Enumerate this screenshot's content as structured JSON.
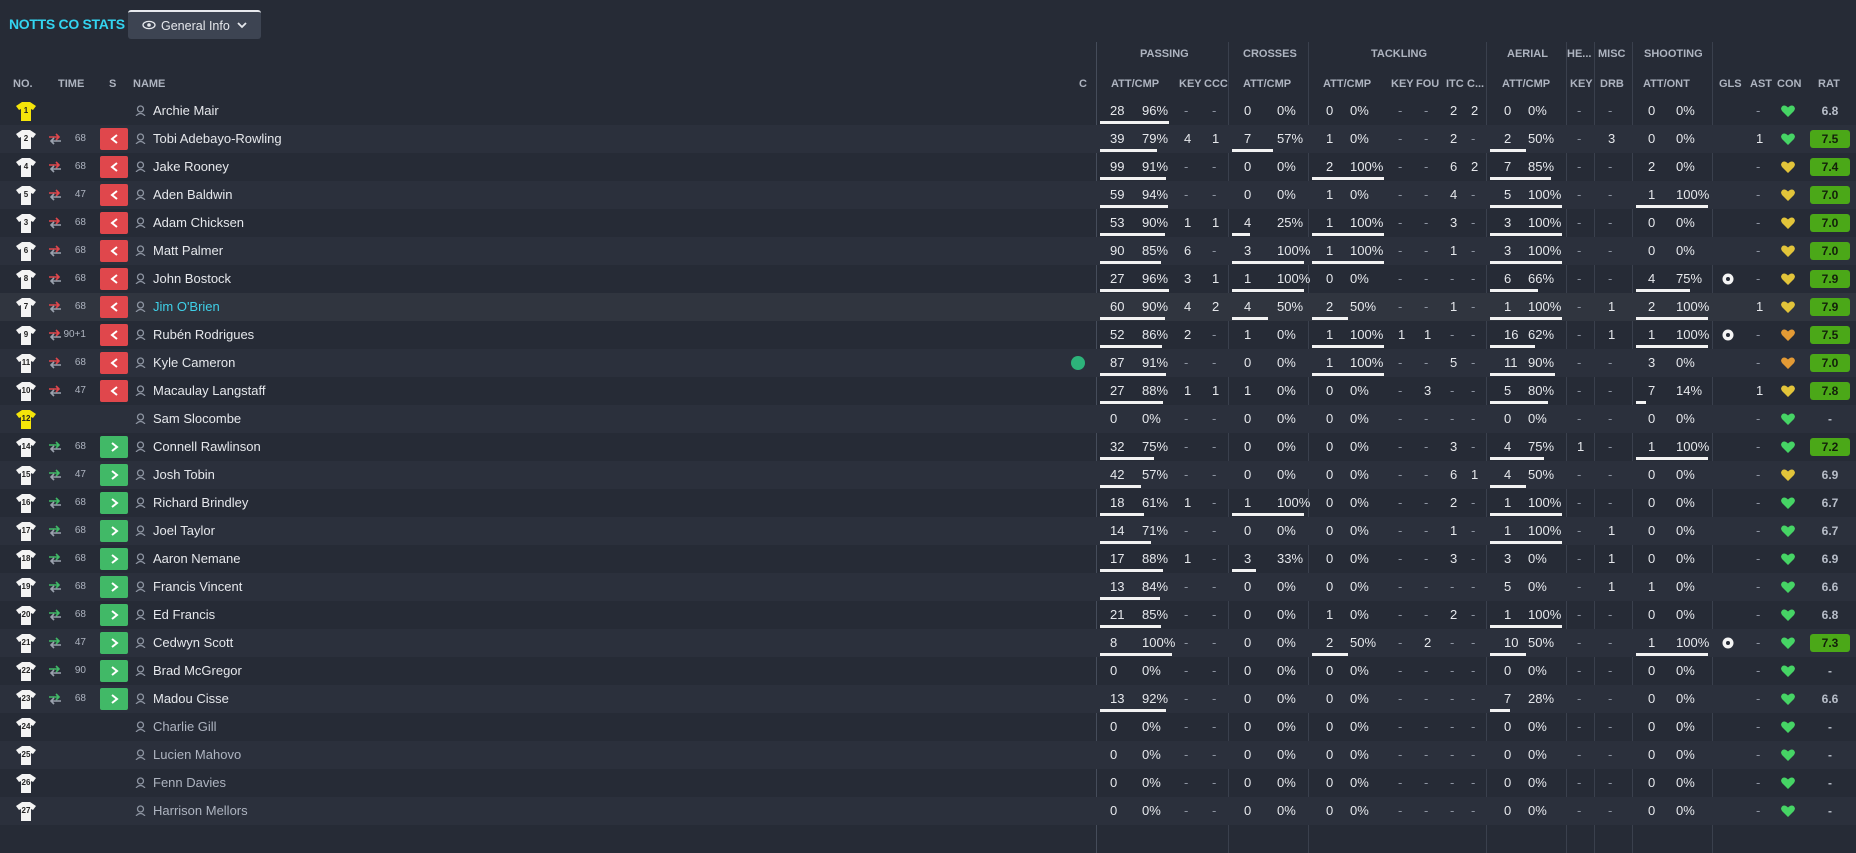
{
  "header": {
    "brand": "NOTTS CO STATS",
    "view_label": "General Info"
  },
  "groups": {
    "passing": "PASSING",
    "crosses": "CROSSES",
    "tackling": "TACKLING",
    "aerial": "AERIAL",
    "headers": "HE...",
    "misc": "MISC",
    "shooting": "SHOOTING"
  },
  "columns": {
    "no": "NO.",
    "time": "TIME",
    "s": "S",
    "name": "NAME",
    "c": "C",
    "pass_att": "ATT/CMP",
    "key": "KEY",
    "ccc": "CCC",
    "cross_att": "ATT/CMP",
    "tack_att": "ATT/CMP",
    "tkey": "KEY",
    "fou": "FOU",
    "itc": "ITC",
    "c2": "C...",
    "aer_att": "ATT/CMP",
    "hkey": "KEY",
    "drb": "DRB",
    "shot_att": "ATT/ONT",
    "gls": "GLS",
    "ast": "AST",
    "con": "CON",
    "rat": "RAT"
  },
  "colors": {
    "accent": "#33d4f0",
    "sub_off": "#e0474c",
    "sub_on": "#41b967",
    "rating_green": "#4ba818"
  },
  "players": [
    {
      "no": "1",
      "gk": true,
      "time": "",
      "sub": "",
      "name": "Archie Mair",
      "pa": "28",
      "pp": "96%",
      "pf": 0.96,
      "key": "-",
      "ccc": "-",
      "ca": "0",
      "cp": "0%",
      "cf": 0,
      "ta": "0",
      "tp": "0%",
      "tf": 0,
      "tk": "-",
      "fou": "-",
      "itc": "2",
      "c2": "2",
      "aa": "0",
      "ap": "0%",
      "af": 0,
      "hk": "-",
      "drb": "-",
      "sa": "0",
      "sp": "0%",
      "sf": 0,
      "gls": "",
      "ast": "-",
      "con": "green",
      "rat": "6.8",
      "rg": false
    },
    {
      "no": "2",
      "gk": false,
      "time": "68",
      "sub": "off",
      "name": "Tobi Adebayo-Rowling",
      "pa": "39",
      "pp": "79%",
      "pf": 0.79,
      "key": "4",
      "ccc": "1",
      "ca": "7",
      "cp": "57%",
      "cf": 0.57,
      "ta": "1",
      "tp": "0%",
      "tf": 0,
      "tk": "-",
      "fou": "-",
      "itc": "2",
      "c2": "-",
      "aa": "2",
      "ap": "50%",
      "af": 0.5,
      "hk": "-",
      "drb": "3",
      "sa": "0",
      "sp": "0%",
      "sf": 0,
      "gls": "",
      "ast": "1",
      "con": "green",
      "rat": "7.5",
      "rg": true
    },
    {
      "no": "4",
      "gk": false,
      "time": "68",
      "sub": "off",
      "name": "Jake Rooney",
      "pa": "99",
      "pp": "91%",
      "pf": 0.91,
      "key": "-",
      "ccc": "-",
      "ca": "0",
      "cp": "0%",
      "cf": 0,
      "ta": "2",
      "tp": "100%",
      "tf": 1,
      "tk": "-",
      "fou": "-",
      "itc": "6",
      "c2": "2",
      "aa": "7",
      "ap": "85%",
      "af": 0.85,
      "hk": "-",
      "drb": "-",
      "sa": "2",
      "sp": "0%",
      "sf": 0,
      "gls": "",
      "ast": "-",
      "con": "yellow",
      "rat": "7.4",
      "rg": true
    },
    {
      "no": "5",
      "gk": false,
      "time": "47",
      "sub": "off",
      "name": "Aden Baldwin",
      "pa": "59",
      "pp": "94%",
      "pf": 0.94,
      "key": "-",
      "ccc": "-",
      "ca": "0",
      "cp": "0%",
      "cf": 0,
      "ta": "1",
      "tp": "0%",
      "tf": 0,
      "tk": "-",
      "fou": "-",
      "itc": "4",
      "c2": "-",
      "aa": "5",
      "ap": "100%",
      "af": 1,
      "hk": "-",
      "drb": "-",
      "sa": "1",
      "sp": "100%",
      "sf": 1,
      "gls": "",
      "ast": "-",
      "con": "yellow",
      "rat": "7.0",
      "rg": true
    },
    {
      "no": "3",
      "gk": false,
      "time": "68",
      "sub": "off",
      "name": "Adam Chicksen",
      "pa": "53",
      "pp": "90%",
      "pf": 0.9,
      "key": "1",
      "ccc": "1",
      "ca": "4",
      "cp": "25%",
      "cf": 0.25,
      "ta": "1",
      "tp": "100%",
      "tf": 1,
      "tk": "-",
      "fou": "-",
      "itc": "3",
      "c2": "-",
      "aa": "3",
      "ap": "100%",
      "af": 1,
      "hk": "-",
      "drb": "-",
      "sa": "0",
      "sp": "0%",
      "sf": 0,
      "gls": "",
      "ast": "-",
      "con": "yellow",
      "rat": "7.0",
      "rg": true
    },
    {
      "no": "6",
      "gk": false,
      "time": "68",
      "sub": "off",
      "name": "Matt Palmer",
      "pa": "90",
      "pp": "85%",
      "pf": 0.85,
      "key": "6",
      "ccc": "-",
      "ca": "3",
      "cp": "100%",
      "cf": 1,
      "ta": "1",
      "tp": "100%",
      "tf": 1,
      "tk": "-",
      "fou": "-",
      "itc": "1",
      "c2": "-",
      "aa": "3",
      "ap": "100%",
      "af": 1,
      "hk": "-",
      "drb": "-",
      "sa": "0",
      "sp": "0%",
      "sf": 0,
      "gls": "",
      "ast": "-",
      "con": "yellow",
      "rat": "7.0",
      "rg": true
    },
    {
      "no": "8",
      "gk": false,
      "time": "68",
      "sub": "off",
      "name": "John Bostock",
      "pa": "27",
      "pp": "96%",
      "pf": 0.96,
      "key": "3",
      "ccc": "1",
      "ca": "1",
      "cp": "100%",
      "cf": 1,
      "ta": "0",
      "tp": "0%",
      "tf": 0,
      "tk": "-",
      "fou": "-",
      "itc": "-",
      "c2": "-",
      "aa": "6",
      "ap": "66%",
      "af": 0.66,
      "hk": "-",
      "drb": "-",
      "sa": "4",
      "sp": "75%",
      "sf": 0.75,
      "gls": "ball",
      "ast": "-",
      "con": "yellow",
      "rat": "7.9",
      "rg": true
    },
    {
      "no": "7",
      "gk": false,
      "time": "68",
      "sub": "off",
      "name": "Jim O'Brien",
      "pa": "60",
      "pp": "90%",
      "pf": 0.9,
      "key": "4",
      "ccc": "2",
      "ca": "4",
      "cp": "50%",
      "cf": 0.5,
      "ta": "2",
      "tp": "50%",
      "tf": 0.5,
      "tk": "-",
      "fou": "-",
      "itc": "1",
      "c2": "-",
      "aa": "1",
      "ap": "100%",
      "af": 1,
      "hk": "-",
      "drb": "1",
      "sa": "2",
      "sp": "100%",
      "sf": 1,
      "gls": "",
      "ast": "1",
      "con": "yellow",
      "rat": "7.9",
      "rg": true,
      "sel": true
    },
    {
      "no": "9",
      "gk": false,
      "time": "90+1",
      "sub": "off",
      "name": "Rubén Rodrigues",
      "pa": "52",
      "pp": "86%",
      "pf": 0.86,
      "key": "2",
      "ccc": "-",
      "ca": "1",
      "cp": "0%",
      "cf": 0,
      "ta": "1",
      "tp": "100%",
      "tf": 1,
      "tk": "1",
      "fou": "1",
      "itc": "-",
      "c2": "-",
      "aa": "16",
      "ap": "62%",
      "af": 0.62,
      "hk": "-",
      "drb": "1",
      "sa": "1",
      "sp": "100%",
      "sf": 1,
      "gls": "ball",
      "ast": "-",
      "con": "orange",
      "rat": "7.5",
      "rg": true
    },
    {
      "no": "11",
      "gk": false,
      "time": "68",
      "sub": "off",
      "name": "Kyle Cameron",
      "pa": "87",
      "pp": "91%",
      "pf": 0.91,
      "key": "-",
      "ccc": "-",
      "ca": "0",
      "cp": "0%",
      "cf": 0,
      "ta": "1",
      "tp": "100%",
      "tf": 1,
      "tk": "-",
      "fou": "-",
      "itc": "5",
      "c2": "-",
      "aa": "11",
      "ap": "90%",
      "af": 0.9,
      "hk": "-",
      "drb": "-",
      "sa": "3",
      "sp": "0%",
      "sf": 0,
      "gls": "",
      "ast": "-",
      "con": "orange",
      "rat": "7.0",
      "rg": true,
      "captain": true
    },
    {
      "no": "10",
      "gk": false,
      "time": "47",
      "sub": "off",
      "name": "Macaulay Langstaff",
      "pa": "27",
      "pp": "88%",
      "pf": 0.88,
      "key": "1",
      "ccc": "1",
      "ca": "1",
      "cp": "0%",
      "cf": 0,
      "ta": "0",
      "tp": "0%",
      "tf": 0,
      "tk": "-",
      "fou": "3",
      "itc": "-",
      "c2": "-",
      "aa": "5",
      "ap": "80%",
      "af": 0.8,
      "hk": "-",
      "drb": "-",
      "sa": "7",
      "sp": "14%",
      "sf": 0.14,
      "gls": "",
      "ast": "1",
      "con": "yellow",
      "rat": "7.8",
      "rg": true
    },
    {
      "no": "12",
      "gk": true,
      "time": "",
      "sub": "",
      "name": "Sam Slocombe",
      "pa": "0",
      "pp": "0%",
      "pf": 0,
      "key": "-",
      "ccc": "-",
      "ca": "0",
      "cp": "0%",
      "cf": 0,
      "ta": "0",
      "tp": "0%",
      "tf": 0,
      "tk": "-",
      "fou": "-",
      "itc": "-",
      "c2": "-",
      "aa": "0",
      "ap": "0%",
      "af": 0,
      "hk": "-",
      "drb": "-",
      "sa": "0",
      "sp": "0%",
      "sf": 0,
      "gls": "",
      "ast": "-",
      "con": "green",
      "rat": "-",
      "rg": false
    },
    {
      "no": "14",
      "gk": false,
      "time": "68",
      "sub": "on",
      "name": "Connell Rawlinson",
      "pa": "32",
      "pp": "75%",
      "pf": 0.75,
      "key": "-",
      "ccc": "-",
      "ca": "0",
      "cp": "0%",
      "cf": 0,
      "ta": "0",
      "tp": "0%",
      "tf": 0,
      "tk": "-",
      "fou": "-",
      "itc": "3",
      "c2": "-",
      "aa": "4",
      "ap": "75%",
      "af": 0.75,
      "hk": "1",
      "drb": "-",
      "sa": "1",
      "sp": "100%",
      "sf": 1,
      "gls": "",
      "ast": "-",
      "con": "green",
      "rat": "7.2",
      "rg": true
    },
    {
      "no": "15",
      "gk": false,
      "time": "47",
      "sub": "on",
      "name": "Josh Tobin",
      "pa": "42",
      "pp": "57%",
      "pf": 0.57,
      "key": "-",
      "ccc": "-",
      "ca": "0",
      "cp": "0%",
      "cf": 0,
      "ta": "0",
      "tp": "0%",
      "tf": 0,
      "tk": "-",
      "fou": "-",
      "itc": "6",
      "c2": "1",
      "aa": "4",
      "ap": "50%",
      "af": 0.5,
      "hk": "-",
      "drb": "-",
      "sa": "0",
      "sp": "0%",
      "sf": 0,
      "gls": "",
      "ast": "-",
      "con": "yellow",
      "rat": "6.9",
      "rg": false
    },
    {
      "no": "16",
      "gk": false,
      "time": "68",
      "sub": "on",
      "name": "Richard Brindley",
      "pa": "18",
      "pp": "61%",
      "pf": 0.61,
      "key": "1",
      "ccc": "-",
      "ca": "1",
      "cp": "100%",
      "cf": 1,
      "ta": "0",
      "tp": "0%",
      "tf": 0,
      "tk": "-",
      "fou": "-",
      "itc": "2",
      "c2": "-",
      "aa": "1",
      "ap": "100%",
      "af": 1,
      "hk": "-",
      "drb": "-",
      "sa": "0",
      "sp": "0%",
      "sf": 0,
      "gls": "",
      "ast": "-",
      "con": "green",
      "rat": "6.7",
      "rg": false
    },
    {
      "no": "17",
      "gk": false,
      "time": "68",
      "sub": "on",
      "name": "Joel Taylor",
      "pa": "14",
      "pp": "71%",
      "pf": 0.71,
      "key": "-",
      "ccc": "-",
      "ca": "0",
      "cp": "0%",
      "cf": 0,
      "ta": "0",
      "tp": "0%",
      "tf": 0,
      "tk": "-",
      "fou": "-",
      "itc": "1",
      "c2": "-",
      "aa": "1",
      "ap": "100%",
      "af": 1,
      "hk": "-",
      "drb": "1",
      "sa": "0",
      "sp": "0%",
      "sf": 0,
      "gls": "",
      "ast": "-",
      "con": "green",
      "rat": "6.7",
      "rg": false
    },
    {
      "no": "18",
      "gk": false,
      "time": "68",
      "sub": "on",
      "name": "Aaron Nemane",
      "pa": "17",
      "pp": "88%",
      "pf": 0.88,
      "key": "1",
      "ccc": "-",
      "ca": "3",
      "cp": "33%",
      "cf": 0.33,
      "ta": "0",
      "tp": "0%",
      "tf": 0,
      "tk": "-",
      "fou": "-",
      "itc": "3",
      "c2": "-",
      "aa": "3",
      "ap": "0%",
      "af": 0,
      "hk": "-",
      "drb": "1",
      "sa": "0",
      "sp": "0%",
      "sf": 0,
      "gls": "",
      "ast": "-",
      "con": "green",
      "rat": "6.9",
      "rg": false
    },
    {
      "no": "19",
      "gk": false,
      "time": "68",
      "sub": "on",
      "name": "Francis Vincent",
      "pa": "13",
      "pp": "84%",
      "pf": 0.84,
      "key": "-",
      "ccc": "-",
      "ca": "0",
      "cp": "0%",
      "cf": 0,
      "ta": "0",
      "tp": "0%",
      "tf": 0,
      "tk": "-",
      "fou": "-",
      "itc": "-",
      "c2": "-",
      "aa": "5",
      "ap": "0%",
      "af": 0,
      "hk": "-",
      "drb": "1",
      "sa": "1",
      "sp": "0%",
      "sf": 0,
      "gls": "",
      "ast": "-",
      "con": "green",
      "rat": "6.6",
      "rg": false
    },
    {
      "no": "20",
      "gk": false,
      "time": "68",
      "sub": "on",
      "name": "Ed Francis",
      "pa": "21",
      "pp": "85%",
      "pf": 0.85,
      "key": "-",
      "ccc": "-",
      "ca": "0",
      "cp": "0%",
      "cf": 0,
      "ta": "1",
      "tp": "0%",
      "tf": 0,
      "tk": "-",
      "fou": "-",
      "itc": "2",
      "c2": "-",
      "aa": "1",
      "ap": "100%",
      "af": 1,
      "hk": "-",
      "drb": "-",
      "sa": "0",
      "sp": "0%",
      "sf": 0,
      "gls": "",
      "ast": "-",
      "con": "green",
      "rat": "6.8",
      "rg": false
    },
    {
      "no": "21",
      "gk": false,
      "time": "47",
      "sub": "on",
      "name": "Cedwyn Scott",
      "pa": "8",
      "pp": "100%",
      "pf": 1,
      "key": "-",
      "ccc": "-",
      "ca": "0",
      "cp": "0%",
      "cf": 0,
      "ta": "2",
      "tp": "50%",
      "tf": 0.5,
      "tk": "-",
      "fou": "2",
      "itc": "-",
      "c2": "-",
      "aa": "10",
      "ap": "50%",
      "af": 0.5,
      "hk": "-",
      "drb": "-",
      "sa": "1",
      "sp": "100%",
      "sf": 1,
      "gls": "ball",
      "ast": "-",
      "con": "green",
      "rat": "7.3",
      "rg": true
    },
    {
      "no": "22",
      "gk": false,
      "time": "90",
      "sub": "on",
      "name": "Brad McGregor",
      "pa": "0",
      "pp": "0%",
      "pf": 0,
      "key": "-",
      "ccc": "-",
      "ca": "0",
      "cp": "0%",
      "cf": 0,
      "ta": "0",
      "tp": "0%",
      "tf": 0,
      "tk": "-",
      "fou": "-",
      "itc": "-",
      "c2": "-",
      "aa": "0",
      "ap": "0%",
      "af": 0,
      "hk": "-",
      "drb": "-",
      "sa": "0",
      "sp": "0%",
      "sf": 0,
      "gls": "",
      "ast": "-",
      "con": "green",
      "rat": "-",
      "rg": false
    },
    {
      "no": "23",
      "gk": false,
      "time": "68",
      "sub": "on",
      "name": "Madou Cisse",
      "pa": "13",
      "pp": "92%",
      "pf": 0.92,
      "key": "-",
      "ccc": "-",
      "ca": "0",
      "cp": "0%",
      "cf": 0,
      "ta": "0",
      "tp": "0%",
      "tf": 0,
      "tk": "-",
      "fou": "-",
      "itc": "-",
      "c2": "-",
      "aa": "7",
      "ap": "28%",
      "af": 0.28,
      "hk": "-",
      "drb": "-",
      "sa": "0",
      "sp": "0%",
      "sf": 0,
      "gls": "",
      "ast": "-",
      "con": "green",
      "rat": "6.6",
      "rg": false
    },
    {
      "no": "24",
      "gk": false,
      "time": "",
      "sub": "",
      "name": "Charlie Gill",
      "dim": true,
      "pa": "0",
      "pp": "0%",
      "pf": 0,
      "key": "-",
      "ccc": "-",
      "ca": "0",
      "cp": "0%",
      "cf": 0,
      "ta": "0",
      "tp": "0%",
      "tf": 0,
      "tk": "-",
      "fou": "-",
      "itc": "-",
      "c2": "-",
      "aa": "0",
      "ap": "0%",
      "af": 0,
      "hk": "-",
      "drb": "-",
      "sa": "0",
      "sp": "0%",
      "sf": 0,
      "gls": "",
      "ast": "-",
      "con": "green",
      "rat": "-",
      "rg": false
    },
    {
      "no": "25",
      "gk": false,
      "time": "",
      "sub": "",
      "name": "Lucien Mahovo",
      "dim": true,
      "pa": "0",
      "pp": "0%",
      "pf": 0,
      "key": "-",
      "ccc": "-",
      "ca": "0",
      "cp": "0%",
      "cf": 0,
      "ta": "0",
      "tp": "0%",
      "tf": 0,
      "tk": "-",
      "fou": "-",
      "itc": "-",
      "c2": "-",
      "aa": "0",
      "ap": "0%",
      "af": 0,
      "hk": "-",
      "drb": "-",
      "sa": "0",
      "sp": "0%",
      "sf": 0,
      "gls": "",
      "ast": "-",
      "con": "green",
      "rat": "-",
      "rg": false
    },
    {
      "no": "26",
      "gk": false,
      "time": "",
      "sub": "",
      "name": "Fenn Davies",
      "dim": true,
      "pa": "0",
      "pp": "0%",
      "pf": 0,
      "key": "-",
      "ccc": "-",
      "ca": "0",
      "cp": "0%",
      "cf": 0,
      "ta": "0",
      "tp": "0%",
      "tf": 0,
      "tk": "-",
      "fou": "-",
      "itc": "-",
      "c2": "-",
      "aa": "0",
      "ap": "0%",
      "af": 0,
      "hk": "-",
      "drb": "-",
      "sa": "0",
      "sp": "0%",
      "sf": 0,
      "gls": "",
      "ast": "-",
      "con": "green",
      "rat": "-",
      "rg": false
    },
    {
      "no": "27",
      "gk": false,
      "time": "",
      "sub": "",
      "name": "Harrison Mellors",
      "dim": true,
      "pa": "0",
      "pp": "0%",
      "pf": 0,
      "key": "-",
      "ccc": "-",
      "ca": "0",
      "cp": "0%",
      "cf": 0,
      "ta": "0",
      "tp": "0%",
      "tf": 0,
      "tk": "-",
      "fou": "-",
      "itc": "-",
      "c2": "-",
      "aa": "0",
      "ap": "0%",
      "af": 0,
      "hk": "-",
      "drb": "-",
      "sa": "0",
      "sp": "0%",
      "sf": 0,
      "gls": "",
      "ast": "-",
      "con": "green",
      "rat": "-",
      "rg": false
    }
  ]
}
